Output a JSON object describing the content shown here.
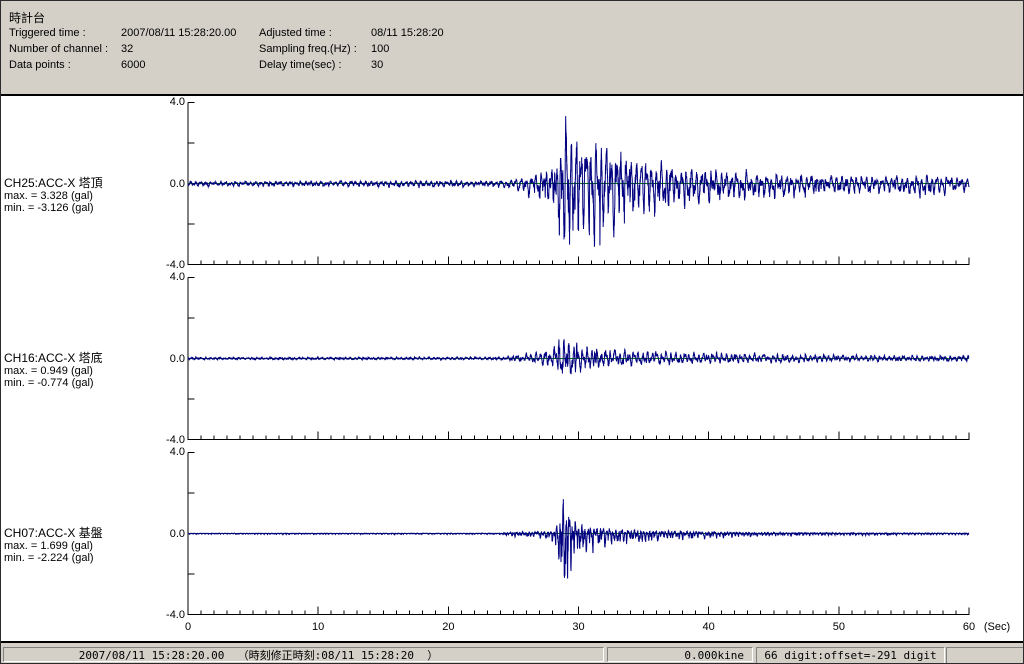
{
  "header": {
    "title": "時計台",
    "fields": [
      {
        "label": "Triggered time :",
        "value": "2007/08/11 15:28:20.00"
      },
      {
        "label": "Adjusted time :",
        "value": "08/11 15:28:20"
      },
      {
        "label": "Number of channel :",
        "value": "32"
      },
      {
        "label": "Sampling freq.(Hz) :",
        "value": "100"
      },
      {
        "label": "Data points :",
        "value": "6000"
      },
      {
        "label": "Delay time(sec) :",
        "value": "30"
      }
    ]
  },
  "status_bar": {
    "segments": [
      "2007/08/11 15:28:20.00  （時刻修正時刻:08/11 15:28:20  ）",
      "0.000kine",
      "66 digit:offset=-291 digit",
      ""
    ]
  },
  "colors": {
    "waveform": "#000080",
    "zero_line": "#008000",
    "axis": "#000000",
    "panel_bg": "#d4d0c8",
    "chart_bg": "#ffffff"
  },
  "chart_data": {
    "type": "line",
    "title": "",
    "sampling_freq_hz": 100,
    "data_points": 6000,
    "x": {
      "label": "(Sec)",
      "min": 0,
      "max": 60,
      "major_ticks": [
        0,
        10,
        20,
        30,
        40,
        50,
        60
      ],
      "tick_labels": [
        "0",
        "10",
        "20",
        "30",
        "40",
        "50",
        "60"
      ],
      "minor_tick_interval_sec": 1
    },
    "y": {
      "unit": "gal",
      "min": -4.0,
      "max": 4.0,
      "tick_labels": [
        "4.0",
        "0.0",
        "-4.0"
      ],
      "minor_ticks": [
        2.0,
        -2.0
      ]
    },
    "series": [
      {
        "id": "CH25",
        "name": "CH25:ACC-X 塔頂",
        "max_text": "max. = 3.328 (gal)",
        "min_text": "min. = -3.126 (gal)",
        "max_gal": 3.328,
        "min_gal": -3.126,
        "dominant_freq_hz": 2.6,
        "envelope_t_gal": [
          [
            0,
            0.12
          ],
          [
            10,
            0.13
          ],
          [
            20,
            0.16
          ],
          [
            24,
            0.16
          ],
          [
            25,
            0.25
          ],
          [
            26,
            0.45
          ],
          [
            27,
            0.65
          ],
          [
            27.8,
            0.9
          ],
          [
            28.4,
            1.8
          ],
          [
            28.9,
            3.3
          ],
          [
            29.6,
            3.0
          ],
          [
            30.5,
            2.6
          ],
          [
            32,
            2.1
          ],
          [
            33.5,
            1.75
          ],
          [
            35,
            1.4
          ],
          [
            36.5,
            1.1
          ],
          [
            38,
            0.95
          ],
          [
            40,
            0.8
          ],
          [
            42,
            0.68
          ],
          [
            45,
            0.55
          ],
          [
            48,
            0.48
          ],
          [
            51,
            0.42
          ],
          [
            54,
            0.4
          ],
          [
            56.5,
            0.52
          ],
          [
            58,
            0.42
          ],
          [
            60,
            0.34
          ]
        ]
      },
      {
        "id": "CH16",
        "name": "CH16:ACC-X 塔底",
        "max_text": "max. = 0.949 (gal)",
        "min_text": "min. = -0.774 (gal)",
        "max_gal": 0.949,
        "min_gal": -0.774,
        "dominant_freq_hz": 2.8,
        "envelope_t_gal": [
          [
            0,
            0.05
          ],
          [
            20,
            0.055
          ],
          [
            24,
            0.06
          ],
          [
            25,
            0.13
          ],
          [
            26,
            0.2
          ],
          [
            27,
            0.28
          ],
          [
            28,
            0.5
          ],
          [
            28.7,
            0.85
          ],
          [
            29.2,
            0.95
          ],
          [
            30,
            0.62
          ],
          [
            31,
            0.5
          ],
          [
            32.5,
            0.4
          ],
          [
            34,
            0.34
          ],
          [
            36,
            0.3
          ],
          [
            38,
            0.26
          ],
          [
            41,
            0.22
          ],
          [
            44,
            0.2
          ],
          [
            48,
            0.17
          ],
          [
            52,
            0.15
          ],
          [
            56,
            0.13
          ],
          [
            60,
            0.12
          ]
        ]
      },
      {
        "id": "CH07",
        "name": "CH07:ACC-X 基盤",
        "max_text": "max. = 1.699 (gal)",
        "min_text": "min. = -2.224 (gal)",
        "max_gal": 1.699,
        "min_gal": -2.224,
        "dominant_freq_hz": 4.2,
        "envelope_t_gal": [
          [
            0,
            0.022
          ],
          [
            20,
            0.024
          ],
          [
            24,
            0.026
          ],
          [
            25,
            0.09
          ],
          [
            26,
            0.11
          ],
          [
            27,
            0.13
          ],
          [
            28,
            0.2
          ],
          [
            28.5,
            0.7
          ],
          [
            28.8,
            2.1
          ],
          [
            29.2,
            1.5
          ],
          [
            29.7,
            0.75
          ],
          [
            30.5,
            0.5
          ],
          [
            31.5,
            0.4
          ],
          [
            33,
            0.3
          ],
          [
            35,
            0.24
          ],
          [
            37,
            0.18
          ],
          [
            39,
            0.14
          ],
          [
            41,
            0.11
          ],
          [
            43,
            0.09
          ],
          [
            46,
            0.07
          ],
          [
            49,
            0.055
          ],
          [
            52,
            0.045
          ],
          [
            56,
            0.04
          ],
          [
            60,
            0.034
          ]
        ]
      }
    ]
  }
}
